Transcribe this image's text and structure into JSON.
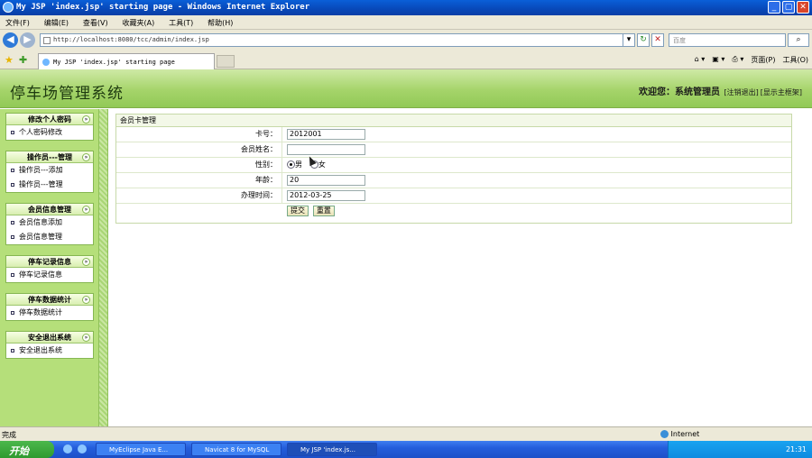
{
  "window": {
    "title": "My JSP 'index.jsp' starting page - Windows Internet Explorer",
    "controls": [
      "_",
      "▢",
      "✕"
    ]
  },
  "menu": [
    "文件(F)",
    "编辑(E)",
    "查看(V)",
    "收藏夹(A)",
    "工具(T)",
    "帮助(H)"
  ],
  "address": {
    "url": "http://localhost:8080/tcc/admin/index.jsp",
    "search_placeholder": "百度"
  },
  "tabs": [
    {
      "label": "My JSP 'index.jsp' starting page"
    }
  ],
  "ie_toolbar": {
    "page_label": "页面(P)",
    "tools_label": "工具(O)"
  },
  "header": {
    "system_title": "停车场管理系统",
    "welcome": "欢迎您：系统管理员",
    "logout_link": "[注销退出]",
    "main_frame_link": "[显示主框架]"
  },
  "sidebar": {
    "groups": [
      {
        "title": "修改个人密码",
        "items": [
          "个人密码修改"
        ]
      },
      {
        "title": "操作员---管理",
        "items": [
          "操作员---添加",
          "操作员---管理"
        ]
      },
      {
        "title": "会员信息管理",
        "items": [
          "会员信息添加",
          "会员信息管理"
        ]
      },
      {
        "title": "停车记录信息",
        "items": [
          "停车记录信息"
        ]
      },
      {
        "title": "停车数据统计",
        "items": [
          "停车数据统计"
        ]
      },
      {
        "title": "安全退出系统",
        "items": [
          "安全退出系统"
        ]
      }
    ]
  },
  "form": {
    "section_title": "会员卡管理",
    "card_no": {
      "label": "卡号：",
      "value": "2012001"
    },
    "member_name": {
      "label": "会员姓名：",
      "value": ""
    },
    "gender": {
      "label": "性别：",
      "options": [
        "男",
        "女"
      ],
      "selected": "男"
    },
    "age": {
      "label": "年龄：",
      "value": "20"
    },
    "issue_date": {
      "label": "办理时间：",
      "value": "2012-03-25"
    },
    "submit_label": "提交",
    "reset_label": "重置"
  },
  "status": {
    "left": "完成",
    "zone": "Internet"
  },
  "taskbar": {
    "start_label": "开始",
    "tasks": [
      "MyEclipse Java E...",
      "Navicat 8 for MySQL",
      "My JSP 'index.js..."
    ],
    "clock": "21:31"
  }
}
